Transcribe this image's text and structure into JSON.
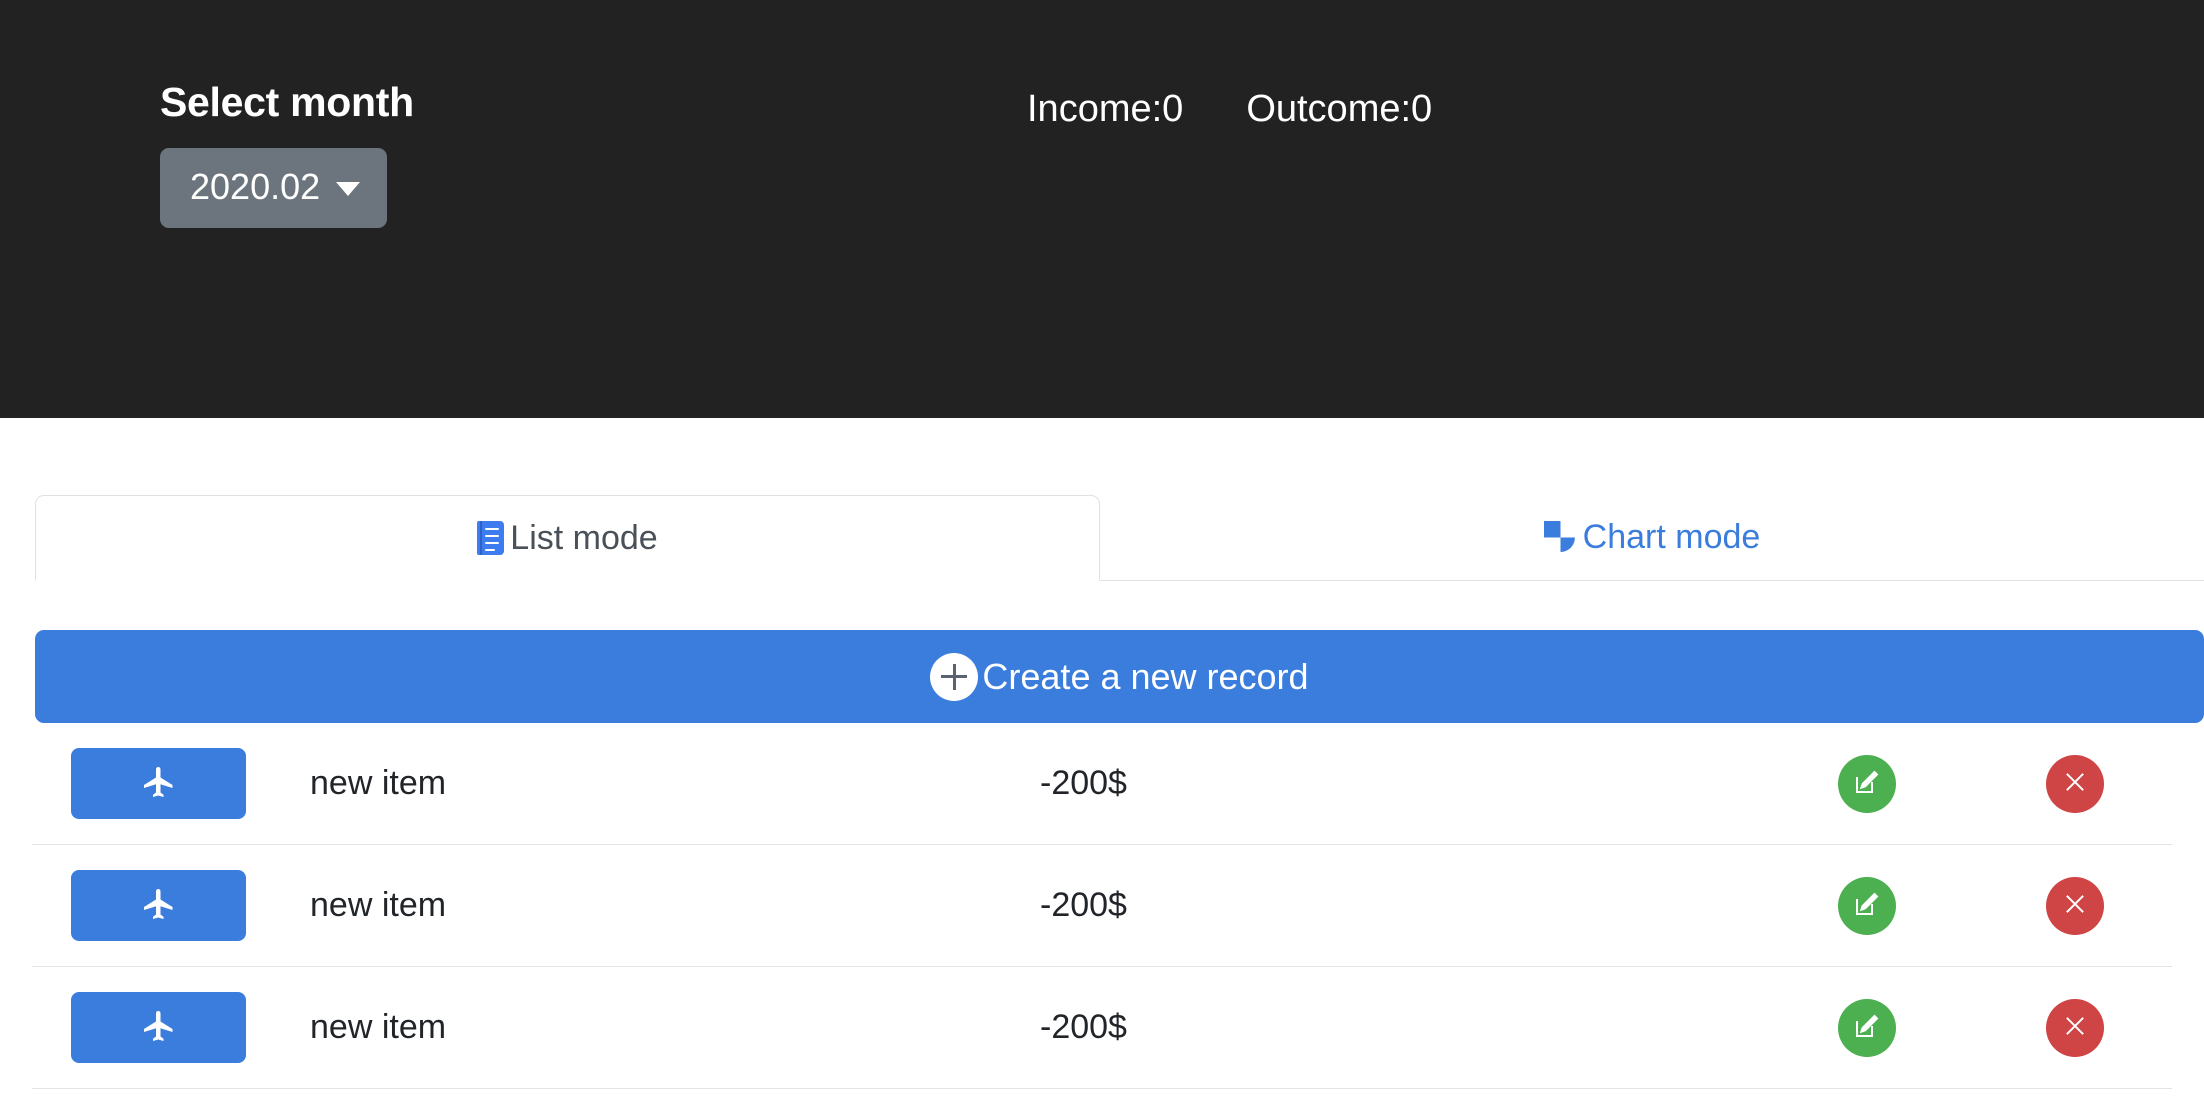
{
  "header": {
    "select_month_label": "Select month",
    "selected_month": "2020.02",
    "caret_icon": "caret-down-icon",
    "income_label": "Income:0",
    "outcome_label": "Outcome:0",
    "background_color": "#222222",
    "dropdown_color": "#6c757d"
  },
  "tabs": [
    {
      "id": "list",
      "label": "List mode",
      "icon": "list-icon",
      "active": true
    },
    {
      "id": "chart",
      "label": "Chart mode",
      "icon": "pie-chart-icon",
      "active": false
    }
  ],
  "create_button": {
    "label": "Create a new record",
    "icon": "plus-circle-icon",
    "color": "#3b7ddd"
  },
  "records": [
    {
      "category_icon": "airplane-icon",
      "title": "new item",
      "amount": "-200$",
      "edit_icon": "edit-icon",
      "delete_icon": "close-icon"
    },
    {
      "category_icon": "airplane-icon",
      "title": "new item",
      "amount": "-200$",
      "edit_icon": "edit-icon",
      "delete_icon": "close-icon"
    },
    {
      "category_icon": "airplane-icon",
      "title": "new item",
      "amount": "-200$",
      "edit_icon": "edit-icon",
      "delete_icon": "close-icon"
    }
  ],
  "colors": {
    "accent": "#3b7ddd",
    "edit": "#4caf50",
    "delete": "#cf4444"
  }
}
